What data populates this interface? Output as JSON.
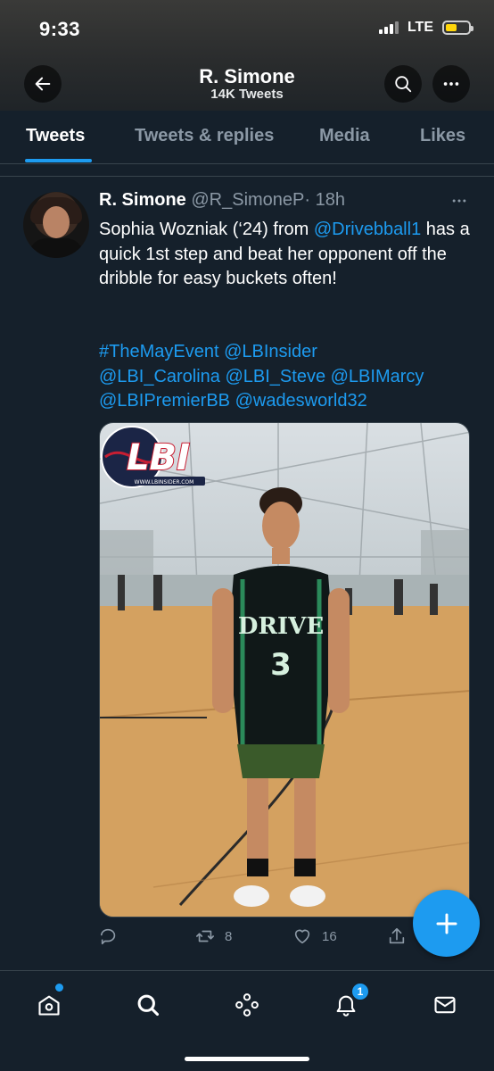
{
  "status_bar": {
    "time": "9:33",
    "network": "LTE",
    "battery_level": 0.45,
    "battery_color": "#ffd60a"
  },
  "header": {
    "title": "R. Simone",
    "subtitle": "14K Tweets"
  },
  "tabs": [
    {
      "label": "Tweets",
      "active": true
    },
    {
      "label": "Tweets & replies",
      "active": false
    },
    {
      "label": "Media",
      "active": false
    },
    {
      "label": "Likes",
      "active": false
    }
  ],
  "tweet": {
    "author_name": "R. Simone",
    "handle": "@R_SimoneP",
    "time": "· 18h",
    "text_before": "Sophia Wozniak (‘24) from ",
    "mention": "@Drivebball1",
    "text_after": " has a quick 1st step and beat her opponent off the dribble for easy buckets often!",
    "tags_line1": "#TheMayEvent @LBInsider",
    "tags_line2": "@LBI_Carolina @LBI_Steve @LBIMarcy",
    "tags_line3": "@LBIPremierBB @wadesworld32",
    "media": {
      "logo_text": "LBI",
      "logo_url_text": "WWW.LBINSIDER.COM",
      "jersey_text": "DRIVE",
      "jersey_number": "3"
    },
    "reply_count": "",
    "retweet_count": "8",
    "like_count": "16"
  },
  "bottom_nav": {
    "notifications_badge": "1"
  },
  "colors": {
    "background": "#15202b",
    "accent": "#1d9bf0",
    "muted": "#8b98a5",
    "border": "#38444d"
  }
}
